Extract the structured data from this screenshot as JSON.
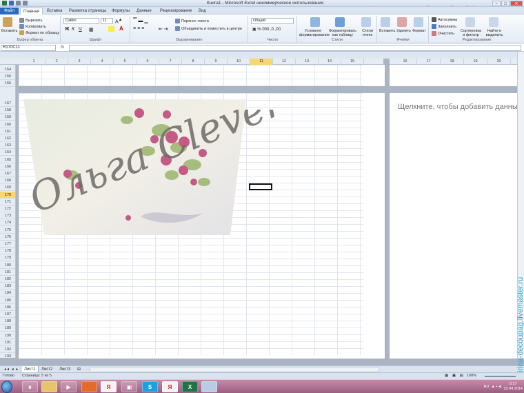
{
  "window": {
    "title": "Книга1 - Microsoft Excel некоммерческое использование",
    "watermark_top": "mastera-rukodeliya.ru",
    "watermark_side": "irina-decoupag.livemaster.ru"
  },
  "tabs": {
    "file": "Файл",
    "home": "Главная",
    "insert": "Вставка",
    "layout": "Разметка страницы",
    "formulas": "Формулы",
    "data": "Данные",
    "review": "Рецензирование",
    "view": "Вид"
  },
  "ribbon": {
    "clipboard": {
      "paste": "Вставить",
      "cut": "Вырезать",
      "copy": "Копировать",
      "format_painter": "Формат по образцу",
      "label": "Буфер обмена"
    },
    "font": {
      "name": "Calibri",
      "size": "11",
      "label": "Шрифт"
    },
    "alignment": {
      "wrap": "Перенос текста",
      "merge": "Объединить и поместить в центре",
      "label": "Выравнивание"
    },
    "number": {
      "format": "Общий",
      "label": "Число"
    },
    "styles": {
      "conditional": "Условное форматирование",
      "as_table": "Форматировать как таблицу",
      "cell_styles": "Стили ячеек",
      "label": "Стили"
    },
    "cells": {
      "insert": "Вставить",
      "delete": "Удалить",
      "format": "Формат",
      "label": "Ячейки"
    },
    "editing": {
      "autosum": "Автосумма",
      "fill": "Заполнить",
      "clear": "Очистить",
      "sort": "Сортировка и фильтр",
      "find": "Найти и выделить",
      "label": "Редактирование"
    }
  },
  "formula_bar": {
    "name_box": "R170C11",
    "fx": "fx",
    "formula": ""
  },
  "ruler": {
    "columns": [
      "1",
      "2",
      "3",
      "4",
      "5",
      "6",
      "7",
      "8",
      "9",
      "10",
      "11",
      "12",
      "13",
      "14",
      "15"
    ],
    "columns_right": [
      "16",
      "17",
      "18",
      "19",
      "20"
    ],
    "selected_column": "11"
  },
  "rows": {
    "top": [
      "154",
      "155",
      "156"
    ],
    "main": [
      "157",
      "158",
      "159",
      "160",
      "161",
      "162",
      "163",
      "164",
      "165",
      "166",
      "167",
      "168",
      "169",
      "170",
      "171",
      "172",
      "173",
      "174",
      "175",
      "176",
      "177",
      "178",
      "179",
      "180",
      "181",
      "182",
      "183",
      "184",
      "185",
      "186",
      "187",
      "188",
      "189",
      "190",
      "191",
      "192",
      "193",
      "194",
      "195"
    ],
    "selected_row": "170"
  },
  "header_prompt": "Щелкните, чтобы добавить данные",
  "image": {
    "signature": "Ольга Clever"
  },
  "sheets": [
    "Лист1",
    "Лист2",
    "Лист3"
  ],
  "active_sheet": "Лист1",
  "status": {
    "ready": "Готово",
    "page": "Страница: 5 из 5",
    "zoom": "100%"
  },
  "taskbar": {
    "lang": "RU",
    "time": "0:17",
    "date": "22.04.2014"
  },
  "colors": {
    "excel_green": "#217346",
    "file_tab": "#2a6bbf",
    "selected_header": "#f7d774",
    "taskbar": "#b77597"
  }
}
